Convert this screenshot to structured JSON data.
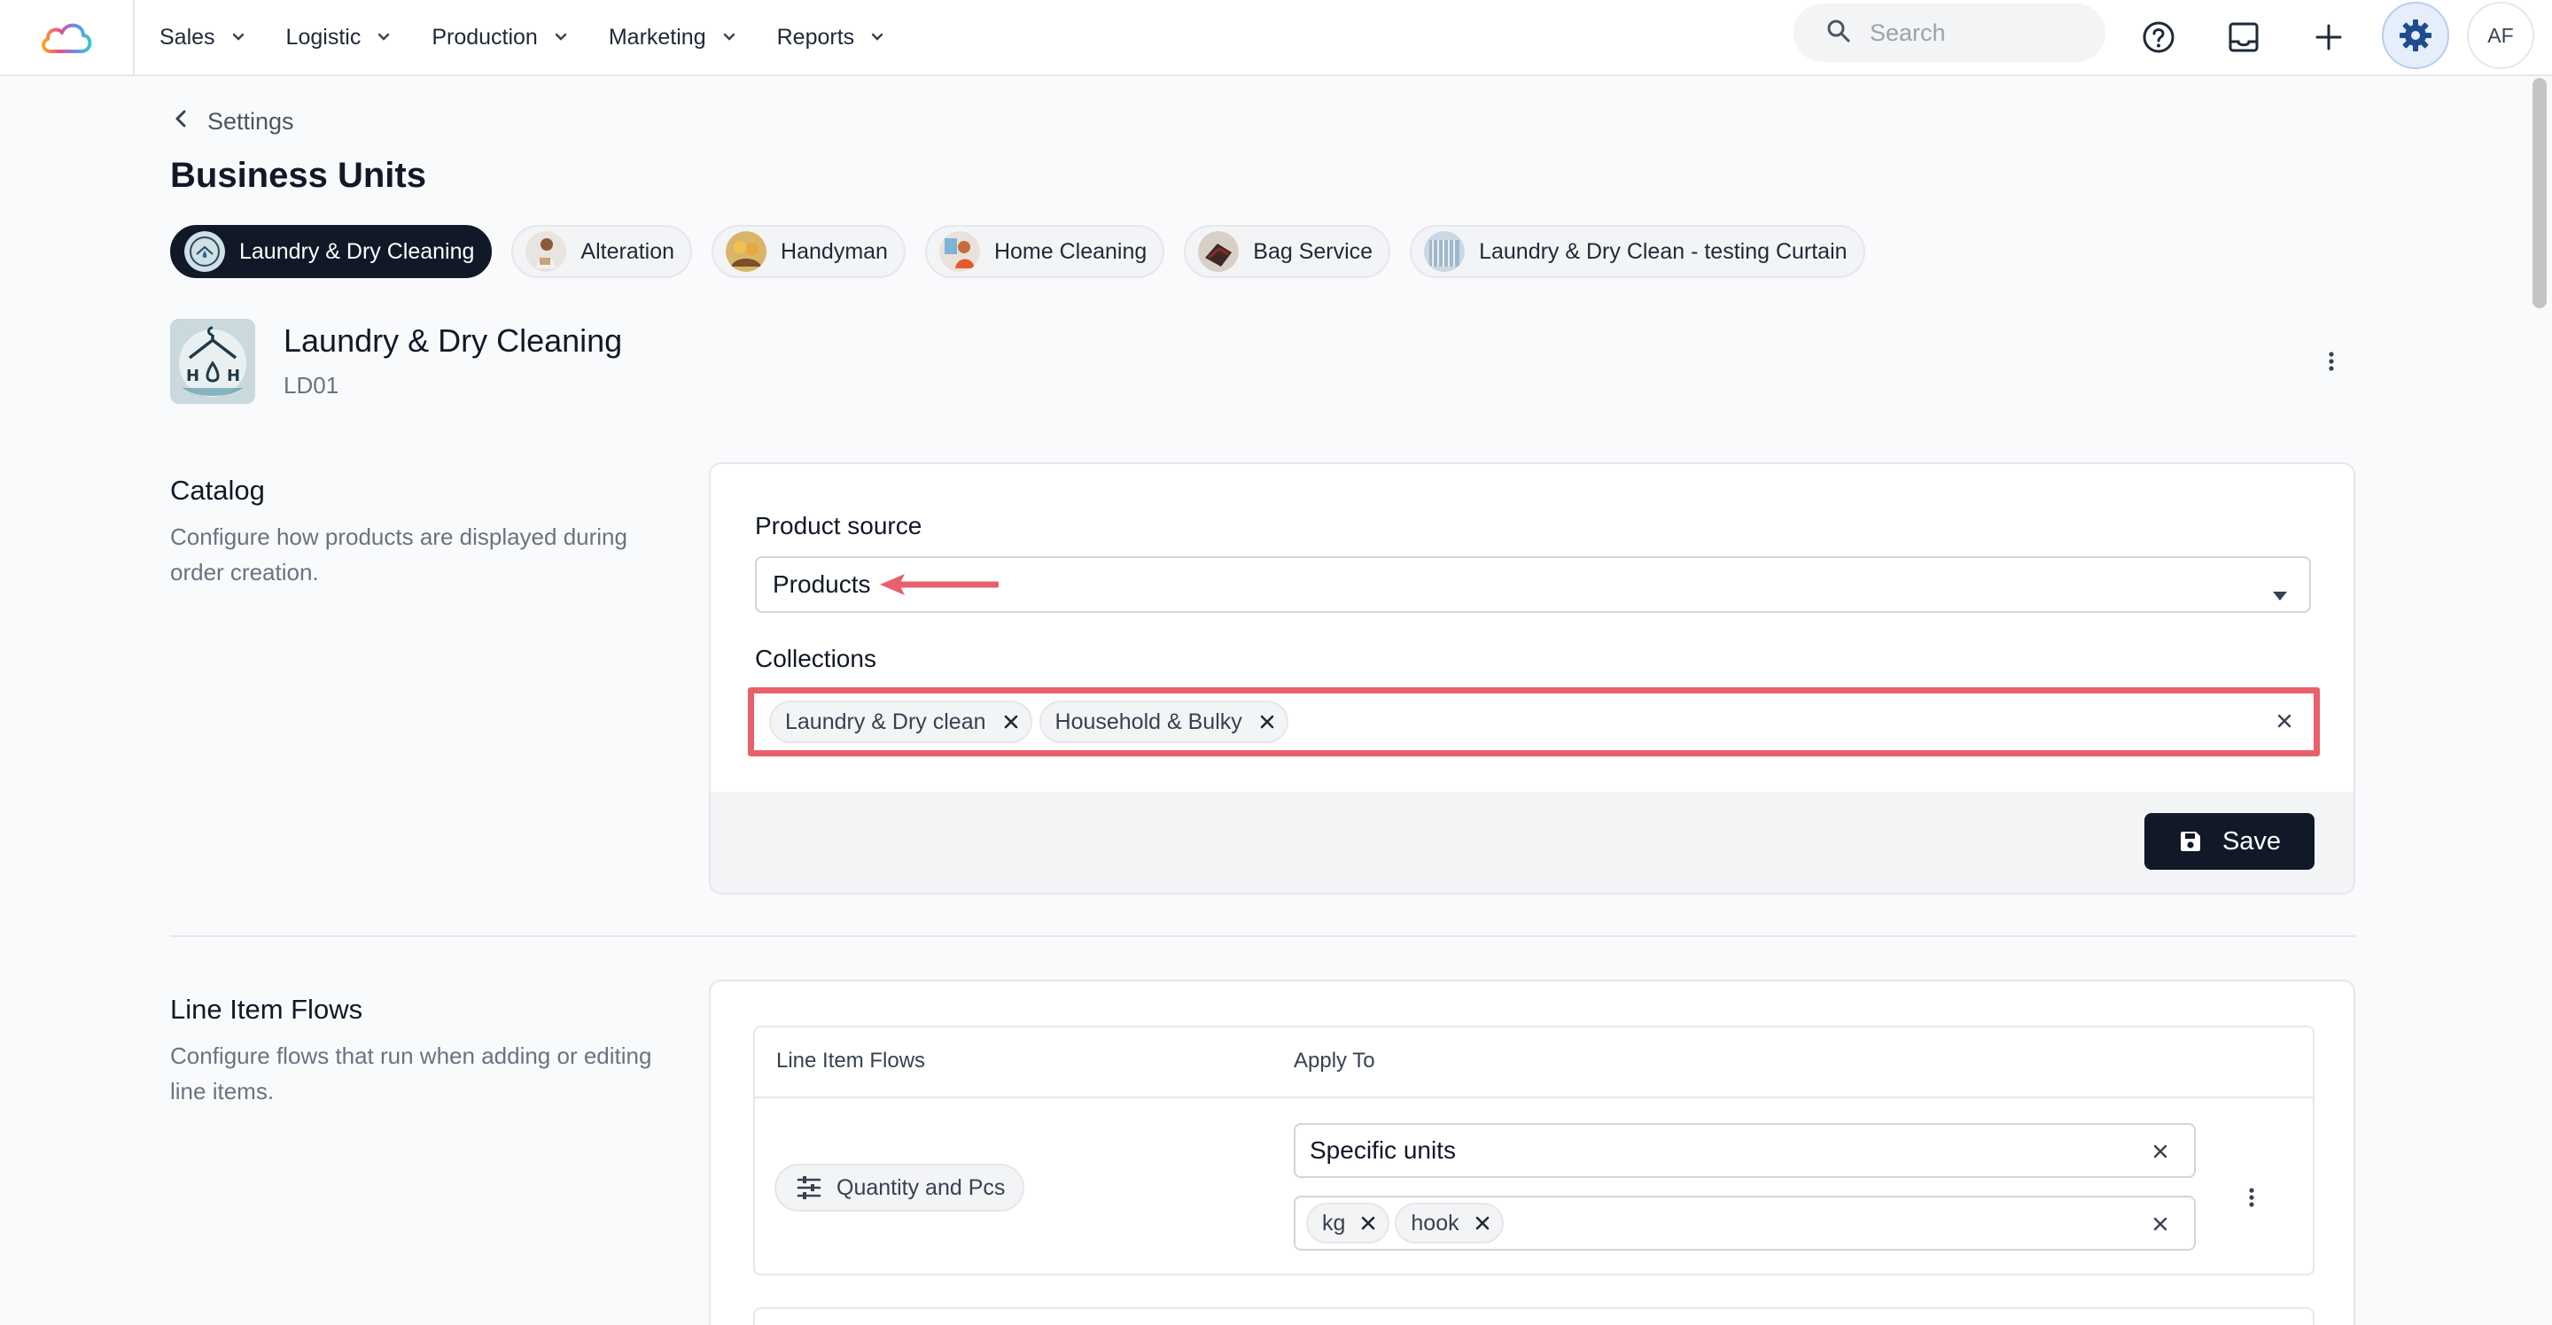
{
  "nav": {
    "menu": [
      {
        "label": "Sales"
      },
      {
        "label": "Logistic"
      },
      {
        "label": "Production"
      },
      {
        "label": "Marketing"
      },
      {
        "label": "Reports"
      }
    ],
    "search_placeholder": "Search",
    "avatar_initials": "AF"
  },
  "header": {
    "back_label": "Settings",
    "title": "Business Units"
  },
  "unit_tabs": [
    {
      "label": "Laundry & Dry Cleaning",
      "active": true
    },
    {
      "label": "Alteration"
    },
    {
      "label": "Handyman"
    },
    {
      "label": "Home Cleaning"
    },
    {
      "label": "Bag Service"
    },
    {
      "label": "Laundry & Dry Clean - testing Curtain"
    }
  ],
  "unit": {
    "name": "Laundry & Dry Cleaning",
    "code": "LD01"
  },
  "catalog": {
    "title": "Catalog",
    "description": "Configure how products are displayed during order creation.",
    "product_source_label": "Product source",
    "product_source_value": "Products",
    "collections_label": "Collections",
    "collections": [
      "Laundry & Dry clean",
      "Household & Bulky"
    ],
    "save_label": "Save"
  },
  "line_item_flows": {
    "title": "Line Item Flows",
    "description": "Configure flows that run when adding or editing line items.",
    "columns": [
      "Line Item Flows",
      "Apply To"
    ],
    "rows": [
      {
        "flow": "Quantity and Pcs",
        "apply_to": "Specific units",
        "units": [
          "kg",
          "hook"
        ]
      }
    ]
  },
  "colors": {
    "accent_dark": "#111827",
    "annotation_red": "#e8606b",
    "gear_active_bg": "#e6eefb",
    "gear_blue": "#1e4c8f"
  }
}
